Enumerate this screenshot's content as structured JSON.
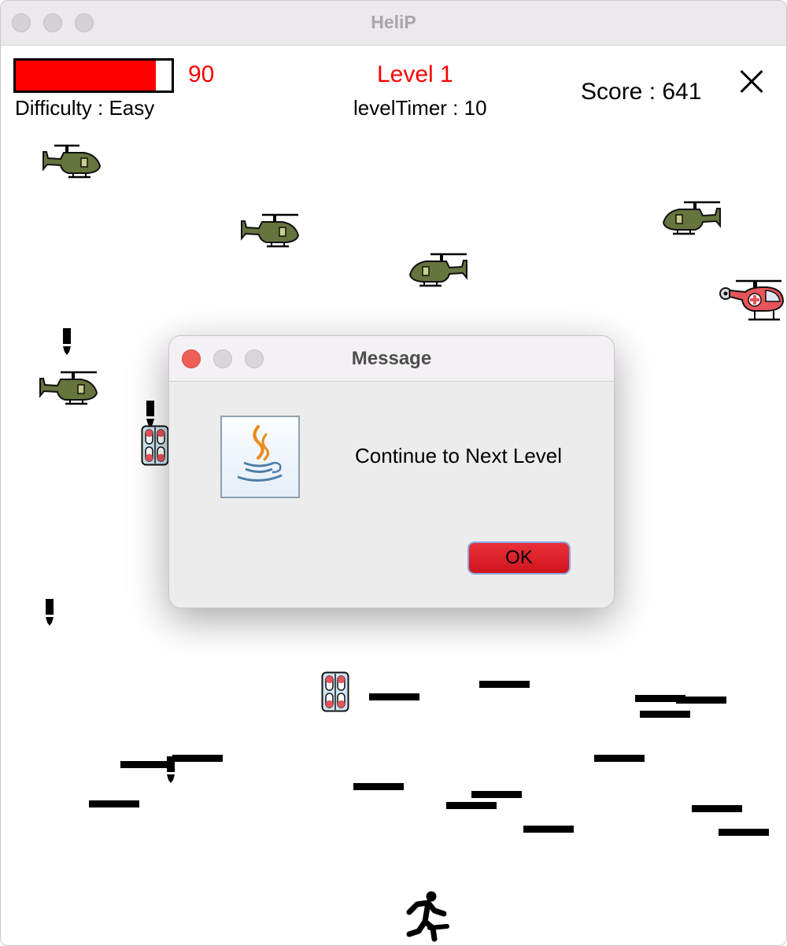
{
  "window": {
    "title": "HeliP"
  },
  "hud": {
    "health_value": "90",
    "health_fraction": 0.9,
    "difficulty": "Difficulty : Easy",
    "level": "Level 1",
    "level_timer": "levelTimer : 10",
    "score": "Score : 641",
    "colors": {
      "health_fill": "#ff0000",
      "level_text": "#ff0000"
    }
  },
  "icons": {
    "close": "close-icon",
    "enemy": "military-helicopter-icon",
    "rescue": "medical-helicopter-icon",
    "bomb": "bomb-icon",
    "pills": "medicine-pack-icon",
    "player": "running-man-icon",
    "java": "java-coffee-icon"
  },
  "dialog": {
    "title": "Message",
    "message": "Continue to Next Level",
    "ok_label": "OK",
    "colors": {
      "close_light": "#ee5f58",
      "ok_button": "#e0222b"
    }
  }
}
